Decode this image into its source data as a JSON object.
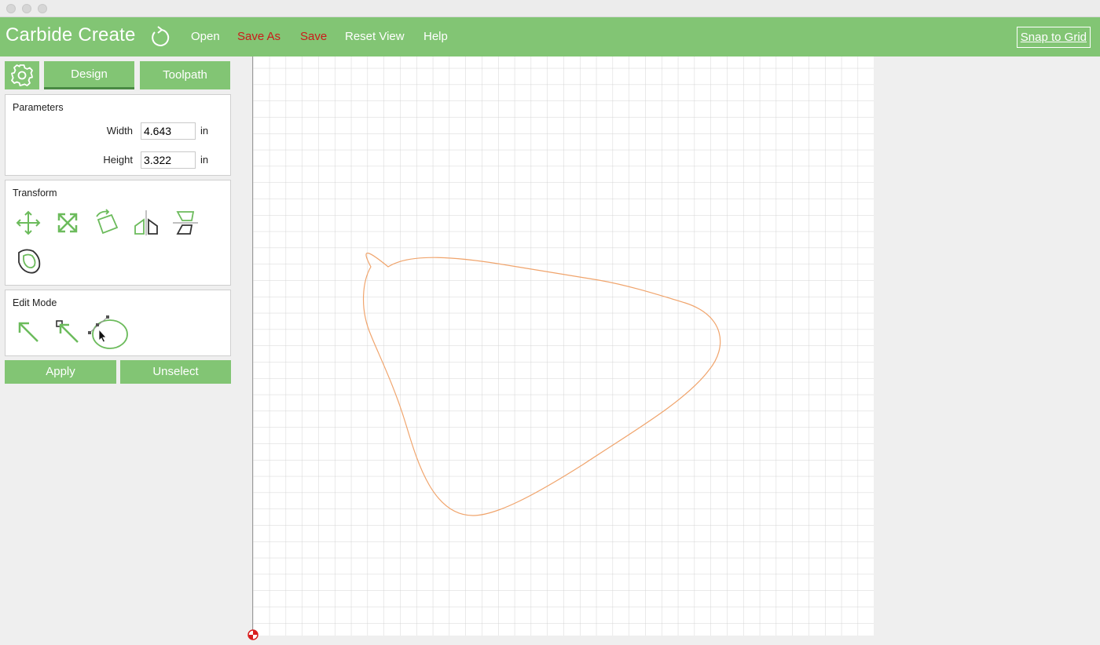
{
  "app": {
    "title": "Carbide Create",
    "menu": [
      {
        "label": "Open",
        "color": "#ffffff"
      },
      {
        "label": "Save As",
        "color": "#cc1a1a"
      },
      {
        "label": "Save",
        "color": "#cc1a1a"
      },
      {
        "label": "Reset View",
        "color": "#ffffff"
      },
      {
        "label": "Help",
        "color": "#ffffff"
      }
    ],
    "snap_label": "Snap to Grid"
  },
  "tabs": {
    "design": "Design",
    "toolpath": "Toolpath"
  },
  "parameters": {
    "title": "Parameters",
    "width_label": "Width",
    "width_value": "4.643",
    "width_unit": "in",
    "height_label": "Height",
    "height_value": "3.322",
    "height_unit": "in"
  },
  "transform": {
    "title": "Transform",
    "icons": [
      "move-icon",
      "scale-icon",
      "rotate-icon",
      "mirror-horizontal-icon",
      "mirror-vertical-icon",
      "offset-icon"
    ]
  },
  "edit_mode": {
    "title": "Edit Mode",
    "icons": [
      "select-arrow-icon",
      "node-select-icon",
      "node-edit-icon"
    ]
  },
  "actions": {
    "apply": "Apply",
    "unselect": "Unselect"
  },
  "colors": {
    "accent": "#82c574",
    "menu_red": "#cc1a1a",
    "icon_green": "#6cbb5c",
    "shape_stroke": "#f0a46c",
    "grid": "#d4d4d4"
  }
}
